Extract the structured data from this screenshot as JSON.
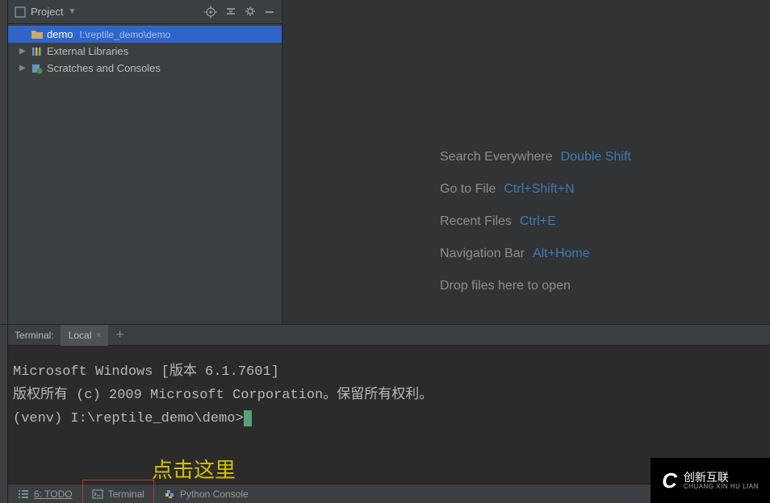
{
  "sidebar": {
    "title": "Project",
    "toolbar_icons": [
      "target",
      "collapse",
      "gear",
      "minimize"
    ],
    "tree": [
      {
        "type": "folder",
        "label": "demo",
        "path": "I:\\reptile_demo\\demo",
        "selected": true
      },
      {
        "type": "lib",
        "label": "External Libraries"
      },
      {
        "type": "scratch",
        "label": "Scratches and Consoles"
      }
    ]
  },
  "editor": {
    "hints": [
      {
        "label": "Search Everywhere",
        "key": "Double Shift"
      },
      {
        "label": "Go to File",
        "key": "Ctrl+Shift+N"
      },
      {
        "label": "Recent Files",
        "key": "Ctrl+E"
      },
      {
        "label": "Navigation Bar",
        "key": "Alt+Home"
      },
      {
        "label": "Drop files here to open",
        "key": ""
      }
    ]
  },
  "terminal": {
    "title": "Terminal:",
    "tab": "Local",
    "lines": [
      "Microsoft Windows [版本 6.1.7601]",
      "版权所有 (c) 2009 Microsoft Corporation。保留所有权利。",
      "",
      "(venv) I:\\reptile_demo\\demo>"
    ],
    "annotation": "点击这里"
  },
  "bottom": {
    "items": [
      {
        "name": "todo",
        "label": "6: TODO",
        "underline": true
      },
      {
        "name": "terminal",
        "label": "Terminal",
        "highlight": true
      },
      {
        "name": "python-console",
        "label": "Python Console"
      }
    ]
  },
  "watermark": {
    "zh": "创新互联",
    "py": "CHUANG XIN HU LIAN"
  }
}
